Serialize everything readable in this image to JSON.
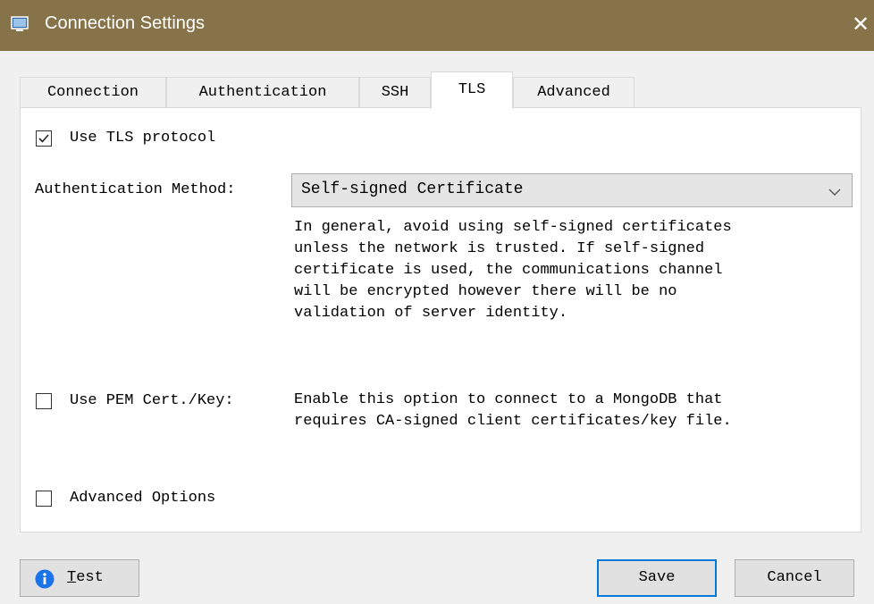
{
  "window": {
    "title": "Connection Settings",
    "close_glyph": "✕"
  },
  "tabs": [
    {
      "label": "Connection",
      "active": false
    },
    {
      "label": "Authentication",
      "active": false
    },
    {
      "label": "SSH",
      "active": false
    },
    {
      "label": "TLS",
      "active": true
    },
    {
      "label": "Advanced",
      "active": false
    }
  ],
  "tls": {
    "use_tls": {
      "label": "Use TLS protocol",
      "checked": true
    },
    "auth_method": {
      "label": "Authentication Method:",
      "value": "Self-signed Certificate",
      "description": "In general, avoid using self-signed certificates\nunless the network is trusted. If self-signed\ncertificate is used, the communications channel\nwill be encrypted however there will be no\nvalidation of server identity."
    },
    "use_pem": {
      "label": "Use PEM Cert./Key:",
      "checked": false,
      "description": "Enable this option to connect to a MongoDB that\nrequires CA-signed client certificates/key file."
    },
    "advanced_options": {
      "label": "Advanced Options",
      "checked": false
    }
  },
  "buttons": {
    "test": {
      "label_mnemonic": "T",
      "label_rest": "est",
      "icon": "info-icon"
    },
    "save": "Save",
    "cancel": "Cancel"
  },
  "colors": {
    "titlebar": "#867349",
    "accent": "#0078d7",
    "info": "#1a73e8"
  }
}
